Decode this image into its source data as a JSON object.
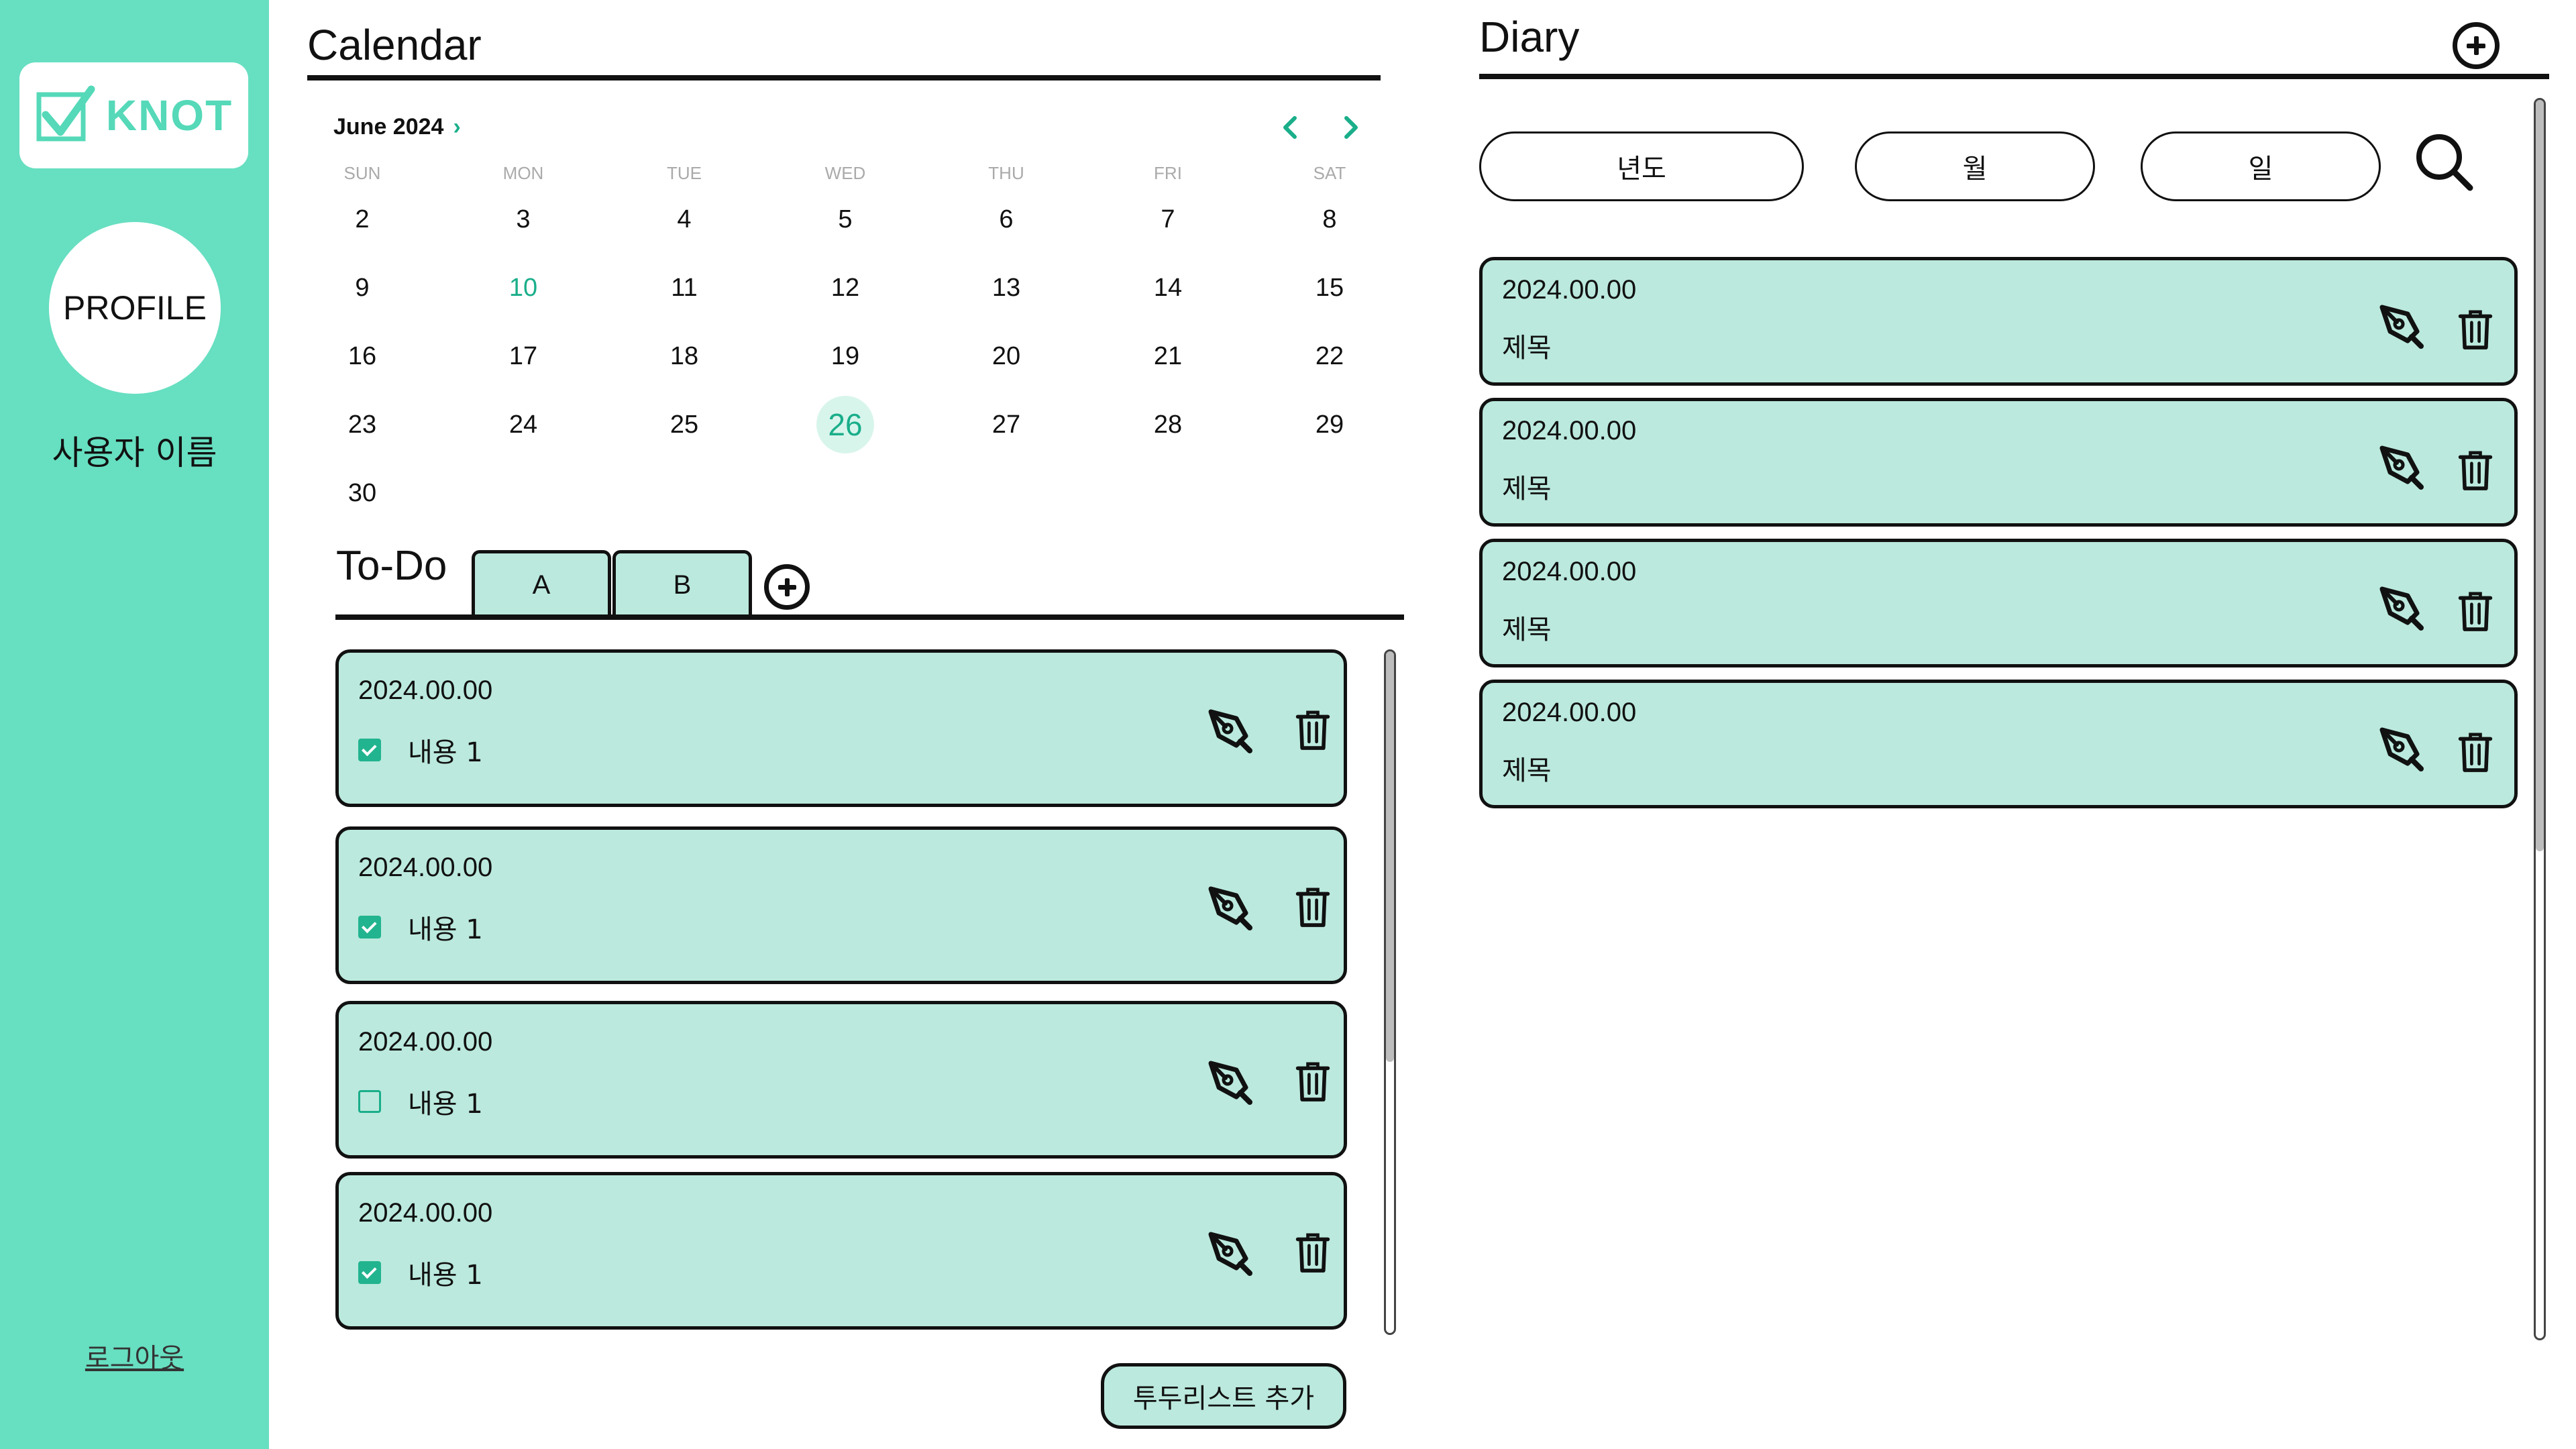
{
  "sidebar": {
    "logo_text": "KNOT",
    "profile_label": "PROFILE",
    "user_name": "사용자 이름",
    "logout_label": "로그아웃"
  },
  "calendar": {
    "title": "Calendar",
    "month_label": "June 2024",
    "weekdays": [
      "SUN",
      "MON",
      "TUE",
      "WED",
      "THU",
      "FRI",
      "SAT"
    ],
    "days": [
      [
        "",
        "",
        "",
        "",
        "",
        "",
        ""
      ],
      [
        "2",
        "3",
        "4",
        "5",
        "6",
        "7",
        "8"
      ],
      [
        "9",
        "10",
        "11",
        "12",
        "13",
        "14",
        "15"
      ],
      [
        "16",
        "17",
        "18",
        "19",
        "20",
        "21",
        "22"
      ],
      [
        "23",
        "24",
        "25",
        "26",
        "27",
        "28",
        "29"
      ],
      [
        "30",
        "",
        "",
        "",
        "",
        "",
        ""
      ]
    ],
    "highlighted_day": "10",
    "selected_day": "26"
  },
  "todo": {
    "title": "To-Do",
    "tabs": [
      "A",
      "B"
    ],
    "items": [
      {
        "date": "2024.00.00",
        "text": "내용 1",
        "checked": true
      },
      {
        "date": "2024.00.00",
        "text": "내용 1",
        "checked": true
      },
      {
        "date": "2024.00.00",
        "text": "내용 1",
        "checked": false
      },
      {
        "date": "2024.00.00",
        "text": "내용 1",
        "checked": true
      }
    ],
    "add_button_label": "투두리스트 추가"
  },
  "diary": {
    "title": "Diary",
    "filters": [
      "년도",
      "월",
      "일"
    ],
    "entries": [
      {
        "date": "2024.00.00",
        "title": "제목"
      },
      {
        "date": "2024.00.00",
        "title": "제목"
      },
      {
        "date": "2024.00.00",
        "title": "제목"
      },
      {
        "date": "2024.00.00",
        "title": "제목"
      }
    ]
  },
  "colors": {
    "sidebar": "#67dfc1",
    "card": "#bbe9dd",
    "accent": "#1aae8a",
    "text": "#111111"
  },
  "icons": {
    "logo": "checkbox-check-icon",
    "edit": "pen-nib-icon",
    "delete": "trash-icon",
    "add": "plus-circle-icon",
    "search": "search-icon",
    "prev": "chevron-left-icon",
    "next": "chevron-right-icon"
  }
}
